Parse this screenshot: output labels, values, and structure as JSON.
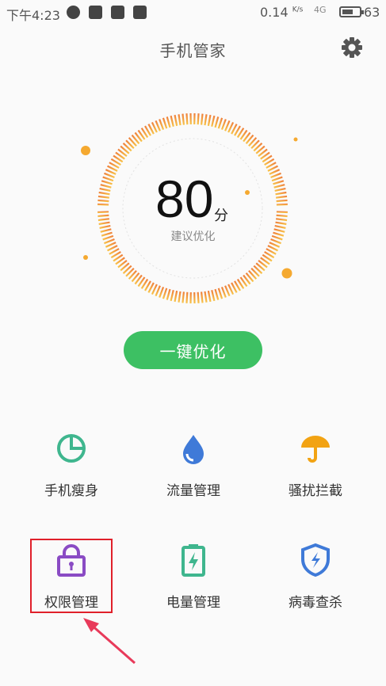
{
  "status_bar": {
    "time": "下午4:23",
    "net_speed": "0.14",
    "net_unit": "K/s",
    "signal": "4G",
    "battery_level": 63,
    "battery_text": "63",
    "notification_icons": [
      "message-icon",
      "qq-icon",
      "mail-icon",
      "video-icon"
    ]
  },
  "header": {
    "title": "手机管家",
    "settings_icon": "gear-icon"
  },
  "score": {
    "value": "80",
    "unit": "分",
    "subtitle": "建议优化"
  },
  "optimize_button": "一键优化",
  "tools": [
    {
      "label": "手机瘦身",
      "icon": "pie-chart-icon",
      "color": "#3fb68e"
    },
    {
      "label": "流量管理",
      "icon": "water-drop-icon",
      "color": "#3f7ad8"
    },
    {
      "label": "骚扰拦截",
      "icon": "umbrella-icon",
      "color": "#f2a313"
    },
    {
      "label": "权限管理",
      "icon": "lock-icon",
      "color": "#8a4bc4"
    },
    {
      "label": "电量管理",
      "icon": "battery-charging-icon",
      "color": "#3fb68e"
    },
    {
      "label": "病毒查杀",
      "icon": "shield-icon",
      "color": "#3f7ad8"
    }
  ],
  "colors": {
    "accent_green": "#3dc063",
    "gauge_start": "#f08a3c",
    "gauge_end": "#f7c046",
    "highlight": "#e0202a"
  }
}
